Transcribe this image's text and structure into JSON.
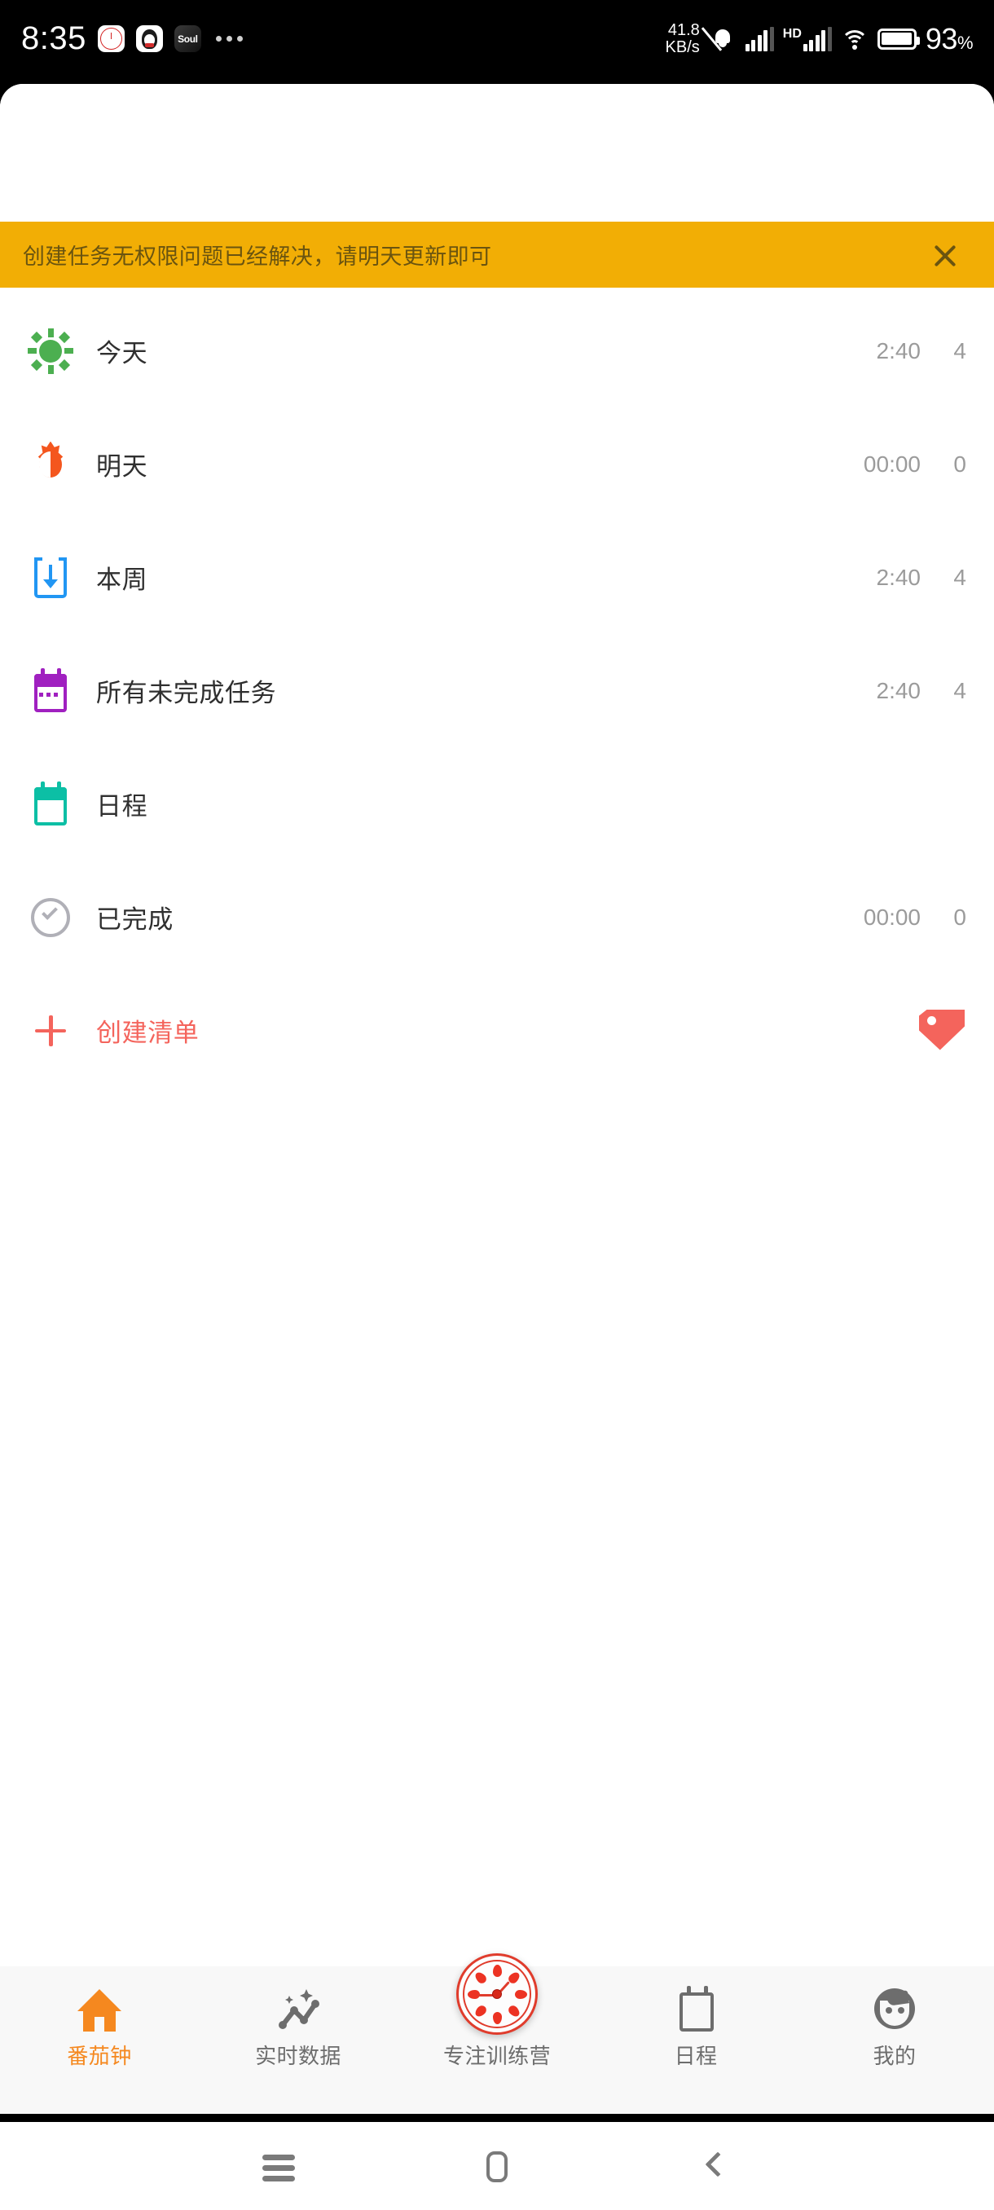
{
  "status_bar": {
    "time": "8:35",
    "app_icons": [
      "tomato-clock-app-icon",
      "qq-app-icon",
      "soul-app-icon"
    ],
    "soul_label": "Soul",
    "overflow_dots": "...",
    "net_speed_value": "41.8",
    "net_speed_unit": "KB/s",
    "mute_icon": "bell-muted-icon",
    "signal_icon": "signal-bars-icon",
    "hd_label": "HD",
    "signal2_icon": "signal-bars-icon",
    "wifi_icon": "wifi-icon",
    "battery_icon": "battery-icon",
    "battery_percent": "93",
    "battery_percent_sign": "%"
  },
  "banner": {
    "message": "创建任务无权限问题已经解决，请明天更新即可",
    "close_icon": "close-icon",
    "background_color": "#F2AE05",
    "text_color": "#6a5410"
  },
  "list": {
    "items": [
      {
        "label": "今天",
        "time": "2:40",
        "count": "4",
        "icon": "sun-icon",
        "color": "#4caf50"
      },
      {
        "label": "明天",
        "time": "00:00",
        "count": "0",
        "icon": "half-sun-icon",
        "color": "#f4561e"
      },
      {
        "label": "本周",
        "time": "2:40",
        "count": "4",
        "icon": "inbox-download-icon",
        "color": "#2196f3"
      },
      {
        "label": "所有未完成任务",
        "time": "2:40",
        "count": "4",
        "icon": "calendar-icon",
        "color": "#a020c0"
      },
      {
        "label": "日程",
        "time": "",
        "count": "",
        "icon": "calendar-icon",
        "color": "#0cbfa5"
      },
      {
        "label": "已完成",
        "time": "00:00",
        "count": "0",
        "icon": "check-circle-icon",
        "color": "#b0b0b7"
      }
    ],
    "create": {
      "label": "创建清单",
      "plus_icon": "plus-icon",
      "tag_icon": "tag-icon",
      "color": "#f4645c"
    }
  },
  "tab_bar": {
    "active_color": "#F5881F",
    "inactive_color": "#6d6d6d",
    "tabs": [
      {
        "label": "番茄钟",
        "icon": "home-icon",
        "active": true
      },
      {
        "label": "实时数据",
        "icon": "chart-line-icon",
        "active": false
      },
      {
        "label": "专注训练营",
        "icon": "tomato-clock-icon",
        "active": false
      },
      {
        "label": "日程",
        "icon": "calendar-icon",
        "active": false
      },
      {
        "label": "我的",
        "icon": "user-face-icon",
        "active": false
      }
    ]
  },
  "android_nav": {
    "recents_icon": "recents-icon",
    "home_icon": "home-square-icon",
    "back_icon": "back-chevron-icon"
  }
}
